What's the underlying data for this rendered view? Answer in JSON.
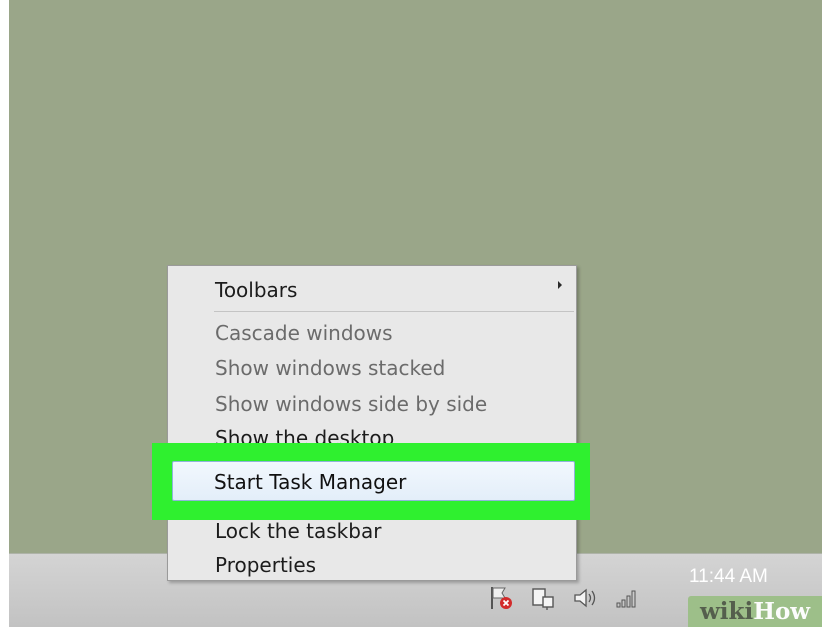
{
  "context_menu": {
    "items": [
      {
        "label": "Toolbars",
        "submenu": true,
        "state": "enabled"
      },
      {
        "label": "Cascade windows",
        "state": "disabled"
      },
      {
        "label": "Show windows stacked",
        "state": "disabled"
      },
      {
        "label": "Show windows side by side",
        "state": "disabled"
      },
      {
        "label": "Show the desktop",
        "state": "enabled"
      },
      {
        "label": "Start Task Manager",
        "state": "highlighted"
      },
      {
        "label": "Lock the taskbar",
        "state": "enabled"
      },
      {
        "label": "Properties",
        "state": "enabled"
      }
    ],
    "highlight_color": "#2ff02f"
  },
  "tray": {
    "icons": [
      "action-center-flag-icon",
      "network-icon",
      "volume-icon",
      "signal-icon"
    ],
    "time": "11:44 AM"
  },
  "watermark": {
    "part1": "wiki",
    "part2": "How"
  },
  "colors": {
    "desktop": "#9aa689",
    "taskbar": "#c8c8c8",
    "menu": "#e8e8e8"
  }
}
